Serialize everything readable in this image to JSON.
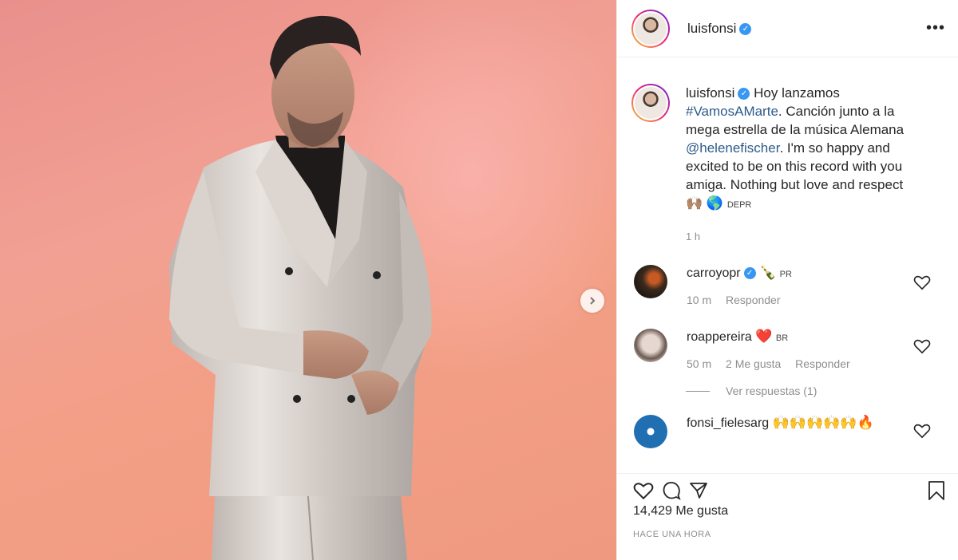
{
  "post": {
    "username": "luisfonsi",
    "more_icon": "more-dots-icon",
    "caption": {
      "username": "luisfonsi",
      "text_1": "Hoy lanzamos",
      "hashtag": "#VamosAMarte",
      "text_2": ". Canción junto a la mega estrella de la música Alemana",
      "mention": "@helenefischer",
      "text_3": ". I'm so happy and excited to be on this record with you amiga. Nothing but love and respect",
      "emoji_1": "🙌🏽",
      "emoji_2": "🌎",
      "flag_text": "DEPR",
      "time": "1 h"
    },
    "comments": [
      {
        "username": "carroyopr",
        "emoji": "🍾",
        "flag_text": "PR",
        "time": "10 m",
        "reply": "Responder",
        "avatar_color": "#3a2a1d"
      },
      {
        "username": "roappereira",
        "emoji": "❤️",
        "flag_text": "BR",
        "time": "50 m",
        "likes": "2 Me gusta",
        "reply": "Responder",
        "avatar_color": "#b9aaa3"
      },
      {
        "username": "fonsi_fielesarg",
        "emoji": "🙌🙌🙌🙌🙌🔥",
        "avatar_color": "#1f6fb2"
      }
    ],
    "view_replies": "Ver respuestas (1)",
    "likes": "14,429 Me gusta",
    "posted": "HACE UNA HORA",
    "accent": "#3897f0"
  }
}
